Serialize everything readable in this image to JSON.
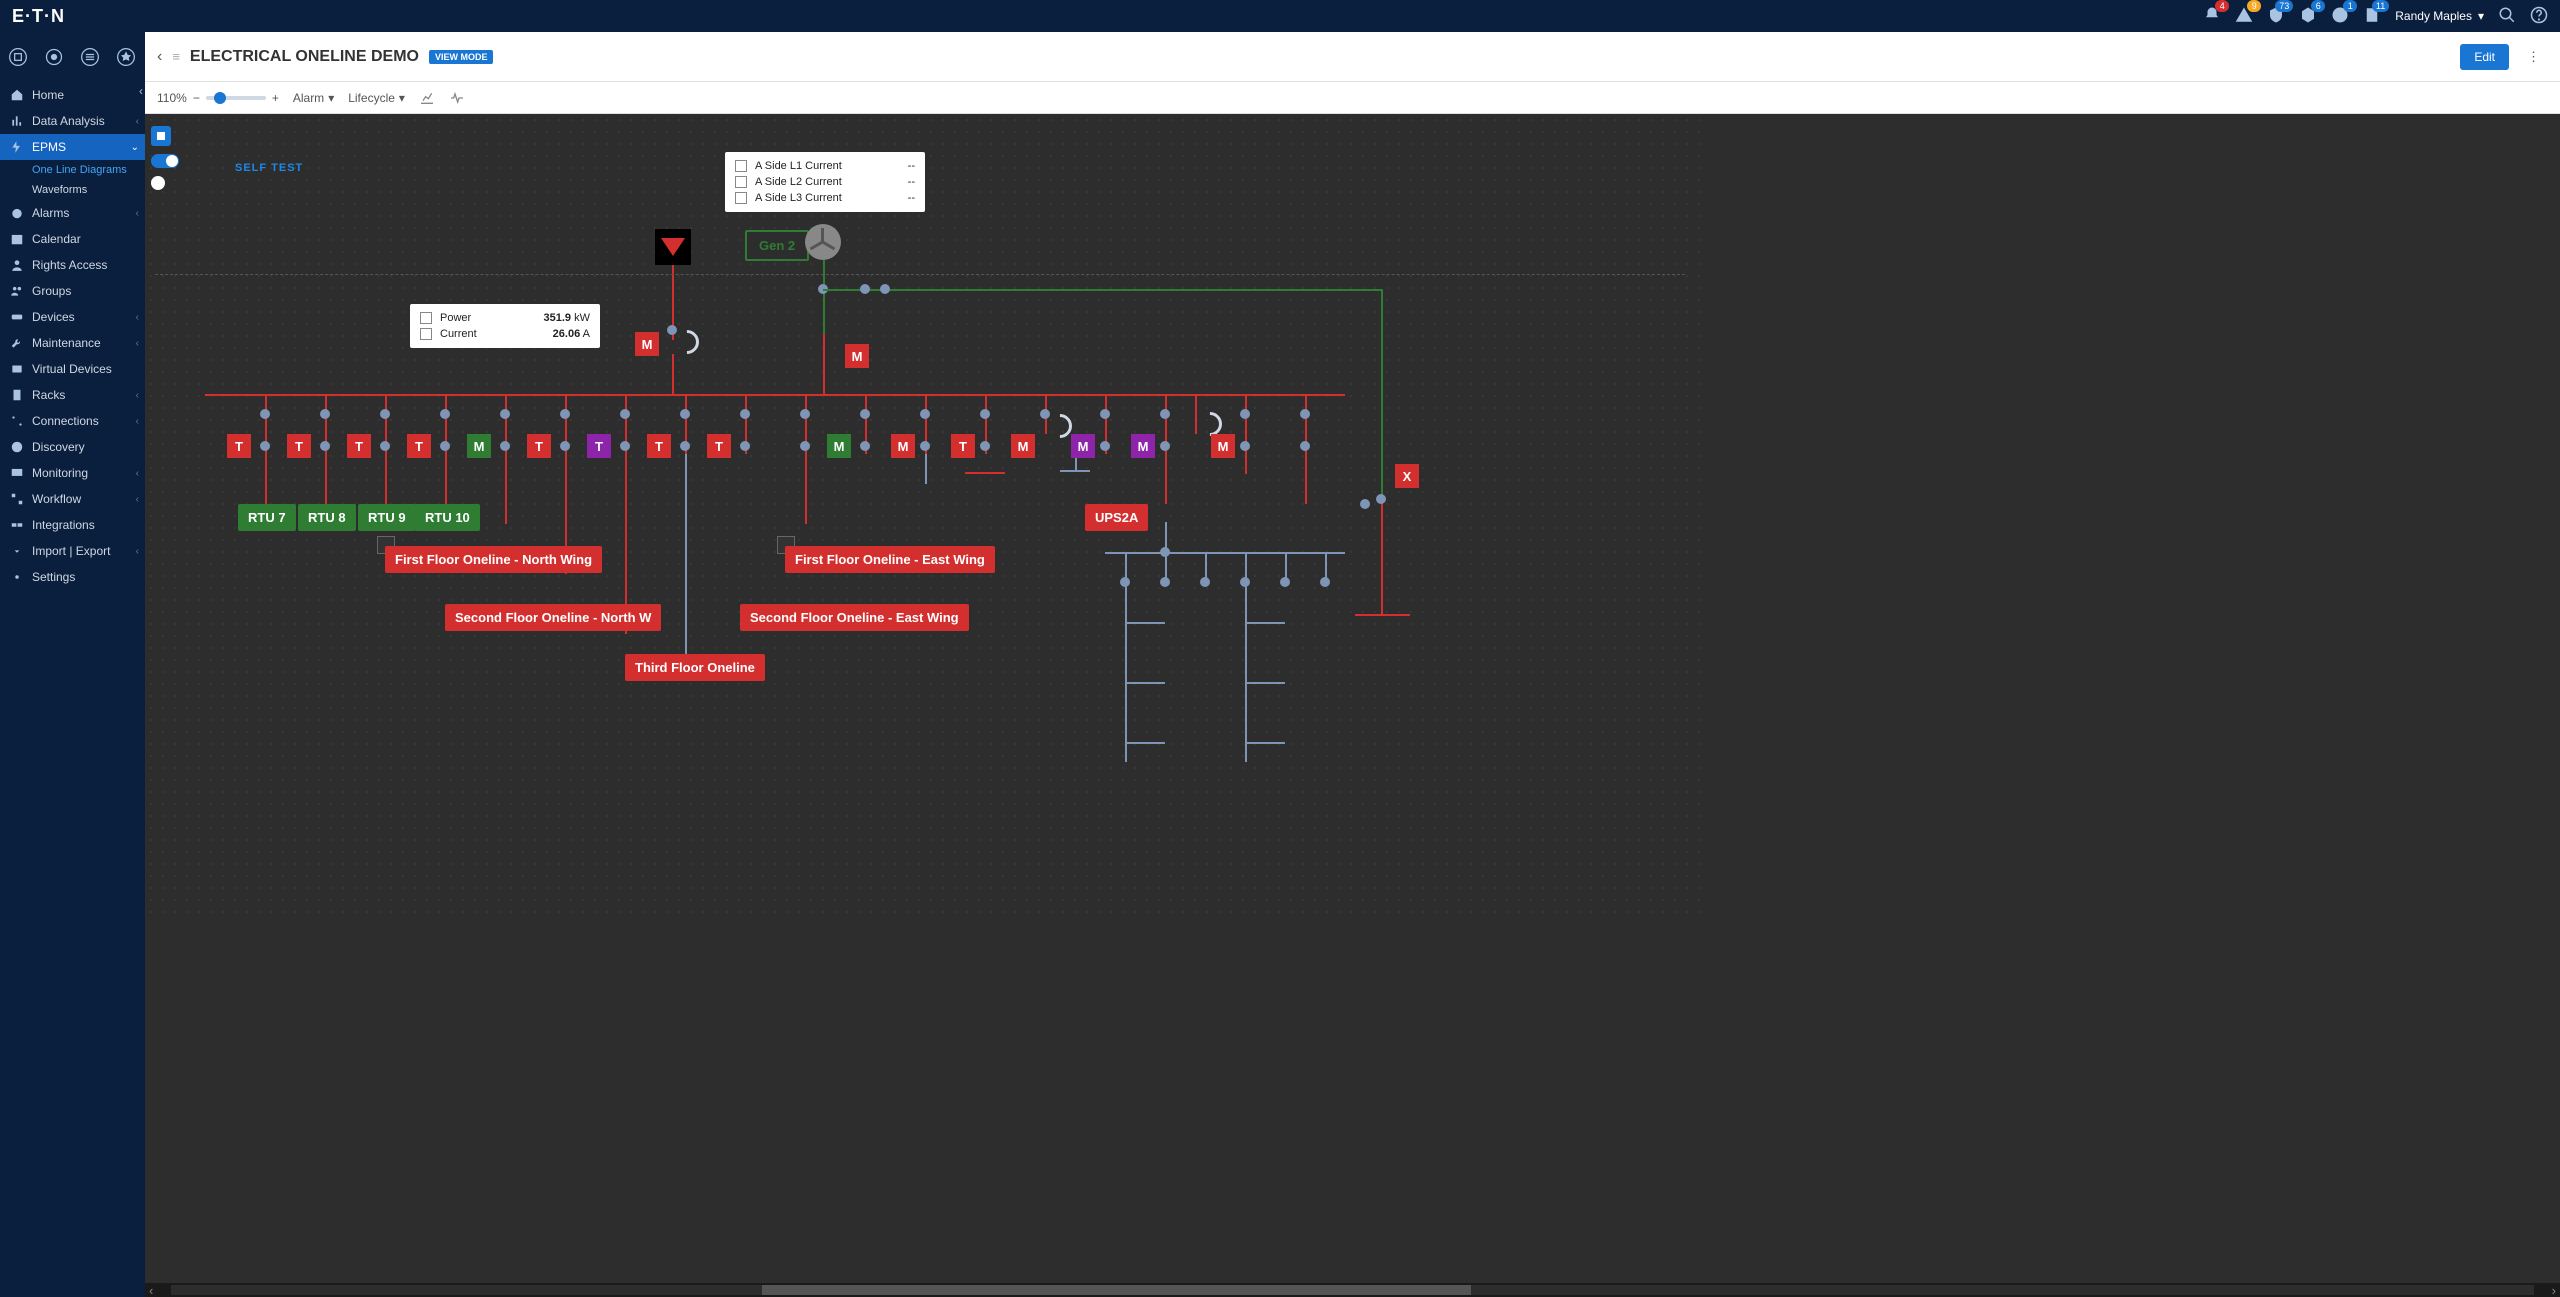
{
  "brand": "E·T·N",
  "user_name": "Randy Maples",
  "badges": {
    "bell": "4",
    "warn": "9",
    "shield": "73",
    "hex": "6",
    "info": "1",
    "page": "11"
  },
  "sidebar": {
    "items": [
      {
        "label": "Home"
      },
      {
        "label": "Data Analysis"
      },
      {
        "label": "EPMS"
      },
      {
        "label": "Alarms"
      },
      {
        "label": "Calendar"
      },
      {
        "label": "Rights Access"
      },
      {
        "label": "Groups"
      },
      {
        "label": "Devices"
      },
      {
        "label": "Maintenance"
      },
      {
        "label": "Virtual Devices"
      },
      {
        "label": "Racks"
      },
      {
        "label": "Connections"
      },
      {
        "label": "Discovery"
      },
      {
        "label": "Monitoring"
      },
      {
        "label": "Workflow"
      },
      {
        "label": "Integrations"
      },
      {
        "label": "Import | Export"
      },
      {
        "label": "Settings"
      }
    ],
    "sub": [
      {
        "label": "One Line Diagrams"
      },
      {
        "label": "Waveforms"
      }
    ]
  },
  "header": {
    "title": "ELECTRICAL ONELINE DEMO",
    "mode": "VIEW MODE",
    "edit": "Edit"
  },
  "toolbar": {
    "zoom": "110%",
    "alarm": "Alarm",
    "lifecycle": "Lifecycle"
  },
  "self_test": "SELF TEST",
  "panel_current": {
    "rows": [
      {
        "label": "A Side L1 Current",
        "val": "--"
      },
      {
        "label": "A Side L2 Current",
        "val": "--"
      },
      {
        "label": "A Side L3 Current",
        "val": "--"
      }
    ]
  },
  "panel_power": {
    "rows": [
      {
        "label": "Power",
        "val": "351.9",
        "unit": "kW"
      },
      {
        "label": "Current",
        "val": "26.06",
        "unit": "A"
      }
    ]
  },
  "gen2": "Gen 2",
  "boxes": {
    "T": "T",
    "M": "M",
    "X": "X"
  },
  "rtu": [
    "RTU 7",
    "RTU 8",
    "RTU 9",
    "RTU 10"
  ],
  "ups": "UPS2A",
  "floor_labels": {
    "first_north": "First Floor Oneline - North Wing",
    "first_east": "First Floor Oneline - East Wing",
    "second_north": "Second Floor Oneline - North W",
    "second_east": "Second Floor Oneline - East Wing",
    "third": "Third Floor Oneline"
  }
}
